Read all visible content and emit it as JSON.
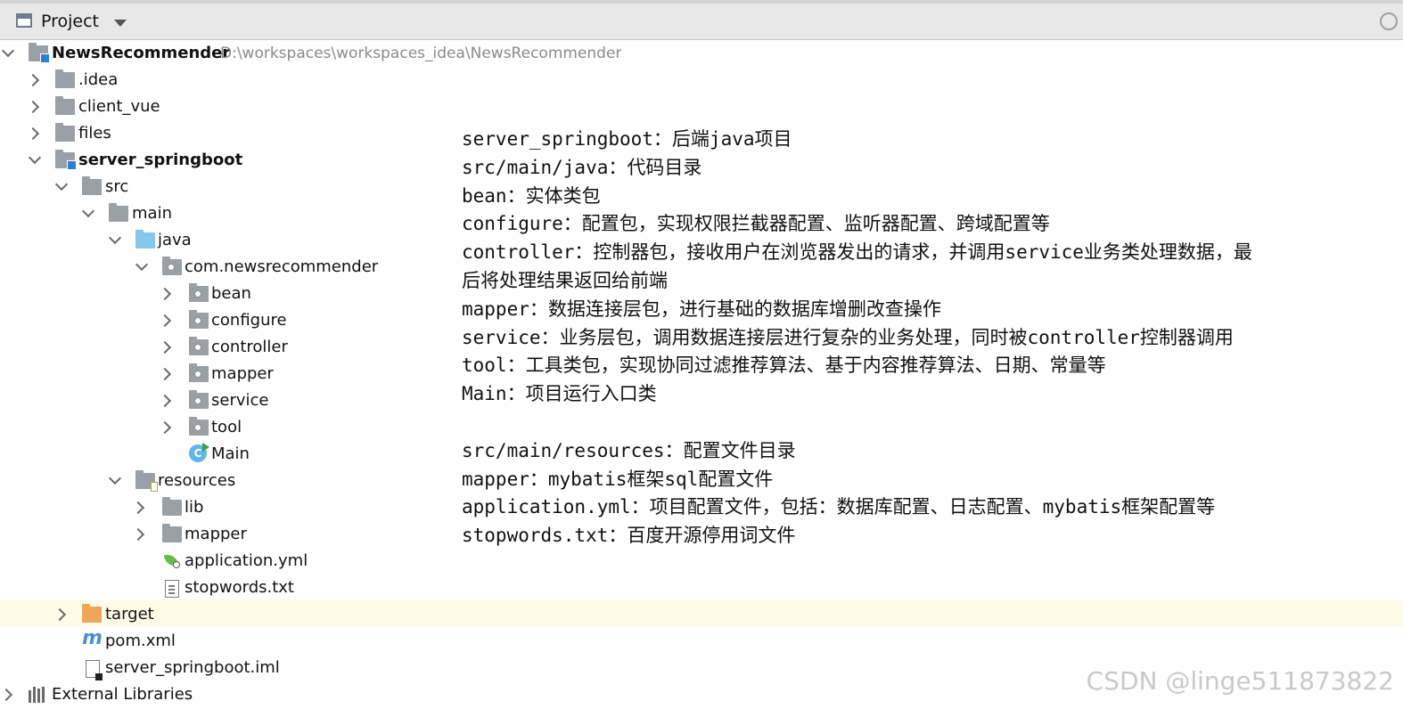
{
  "panel": {
    "title": "Project",
    "dropdown_icon": "caret-down-icon"
  },
  "tree": {
    "root_name": "NewsRecommender",
    "root_path": "D:\\workspaces\\workspaces_idea\\NewsRecommender",
    "items": [
      {
        "label": ".idea"
      },
      {
        "label": "client_vue"
      },
      {
        "label": "files"
      },
      {
        "label": "server_springboot"
      },
      {
        "label": "src"
      },
      {
        "label": "main"
      },
      {
        "label": "java"
      },
      {
        "label": "com.newsrecommender"
      },
      {
        "label": "bean"
      },
      {
        "label": "configure"
      },
      {
        "label": "controller"
      },
      {
        "label": "mapper"
      },
      {
        "label": "service"
      },
      {
        "label": "tool"
      },
      {
        "label": "Main"
      },
      {
        "label": "resources"
      },
      {
        "label": "lib"
      },
      {
        "label": "mapper"
      },
      {
        "label": "application.yml"
      },
      {
        "label": "stopwords.txt"
      },
      {
        "label": "target"
      },
      {
        "label": "pom.xml"
      },
      {
        "label": "server_springboot.iml"
      },
      {
        "label": "External Libraries"
      }
    ]
  },
  "notes": [
    "server_springboot：后端java项目",
    "src/main/java：代码目录",
    "bean：实体类包",
    "configure：配置包，实现权限拦截器配置、监听器配置、跨域配置等",
    "controller：控制器包，接收用户在浏览器发出的请求，并调用service业务类处理数据，最",
    "后将处理结果返回给前端",
    "mapper：数据连接层包，进行基础的数据库增删改查操作",
    "service：业务层包，调用数据连接层进行复杂的业务处理，同时被controller控制器调用",
    "tool：工具类包，实现协同过滤推荐算法、基于内容推荐算法、日期、常量等",
    "Main：项目运行入口类",
    "",
    "src/main/resources：配置文件目录",
    "mapper：mybatis框架sql配置文件",
    "application.yml：项目配置文件，包括：数据库配置、日志配置、mybatis框架配置等",
    "stopwords.txt：百度开源停用词文件"
  ],
  "watermark": "CSDN @linge511873822"
}
